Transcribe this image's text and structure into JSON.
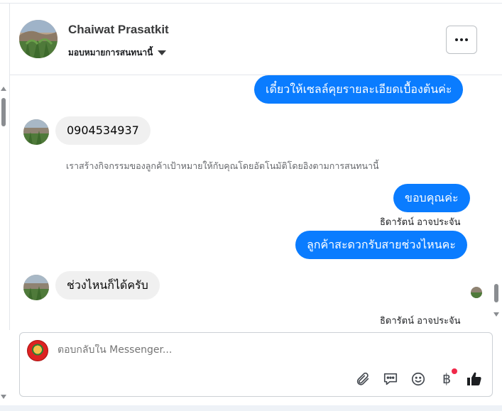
{
  "header": {
    "contact_name": "Chaiwat Prasatkit",
    "assign_label": "มอบหมายการสนทนานี้"
  },
  "messages": [
    {
      "direction": "out",
      "text": "เดี๋ยวให้เซลล์คุยรายละเอียดเบื้องต้นค่ะ"
    },
    {
      "direction": "in",
      "text": "0904534937"
    },
    {
      "direction": "system",
      "text": "เราสร้างกิจกรรมของลูกค้าเป้าหมายให้กับคุณโดยอัตโนมัติโดยอิงตามการสนทนานี้"
    },
    {
      "direction": "out",
      "text": "ขอบคุณค่ะ"
    },
    {
      "direction": "sender",
      "text": "ธิดารัตน์ อาจประจัน"
    },
    {
      "direction": "out",
      "text": "ลูกค้าสะดวกรับสายช่วงไหนคะ"
    },
    {
      "direction": "in",
      "text": "ช่วงไหนก็ได้ครับ"
    },
    {
      "direction": "sender",
      "text": "ธิดารัตน์ อาจประจัน"
    }
  ],
  "composer": {
    "placeholder": "ตอบกลับใน Messenger...",
    "baht_symbol": "฿"
  },
  "icons": [
    "more-icon",
    "caret-down-icon",
    "attachment-icon",
    "saved-reply-icon",
    "emoji-icon",
    "baht-icon",
    "thumbs-up-icon"
  ],
  "colors": {
    "outgoing_bubble": "#0a7cff",
    "incoming_bubble": "#f0f0f0",
    "notification_dot": "#f02849"
  }
}
